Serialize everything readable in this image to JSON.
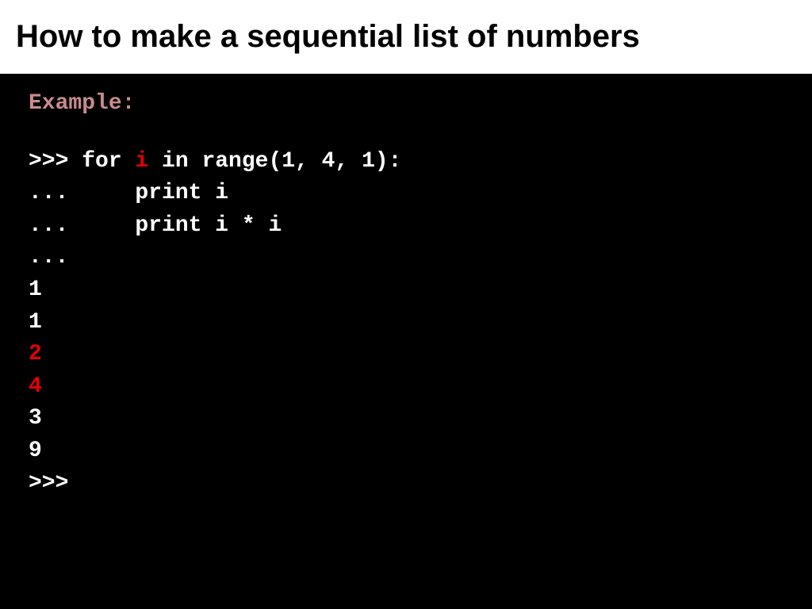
{
  "title": "How to make a sequential list of numbers",
  "example_label": "Example:",
  "code": {
    "l1a": ">>> for ",
    "l1b": "i",
    "l1c": " in range(1, 4, 1):",
    "l2": "...     print i",
    "l3": "...     print i * i",
    "l4": "...",
    "l5": "1",
    "l6": "1",
    "l7": "2",
    "l8": "4",
    "l9": "3",
    "l10": "9",
    "l11": ">>>"
  }
}
